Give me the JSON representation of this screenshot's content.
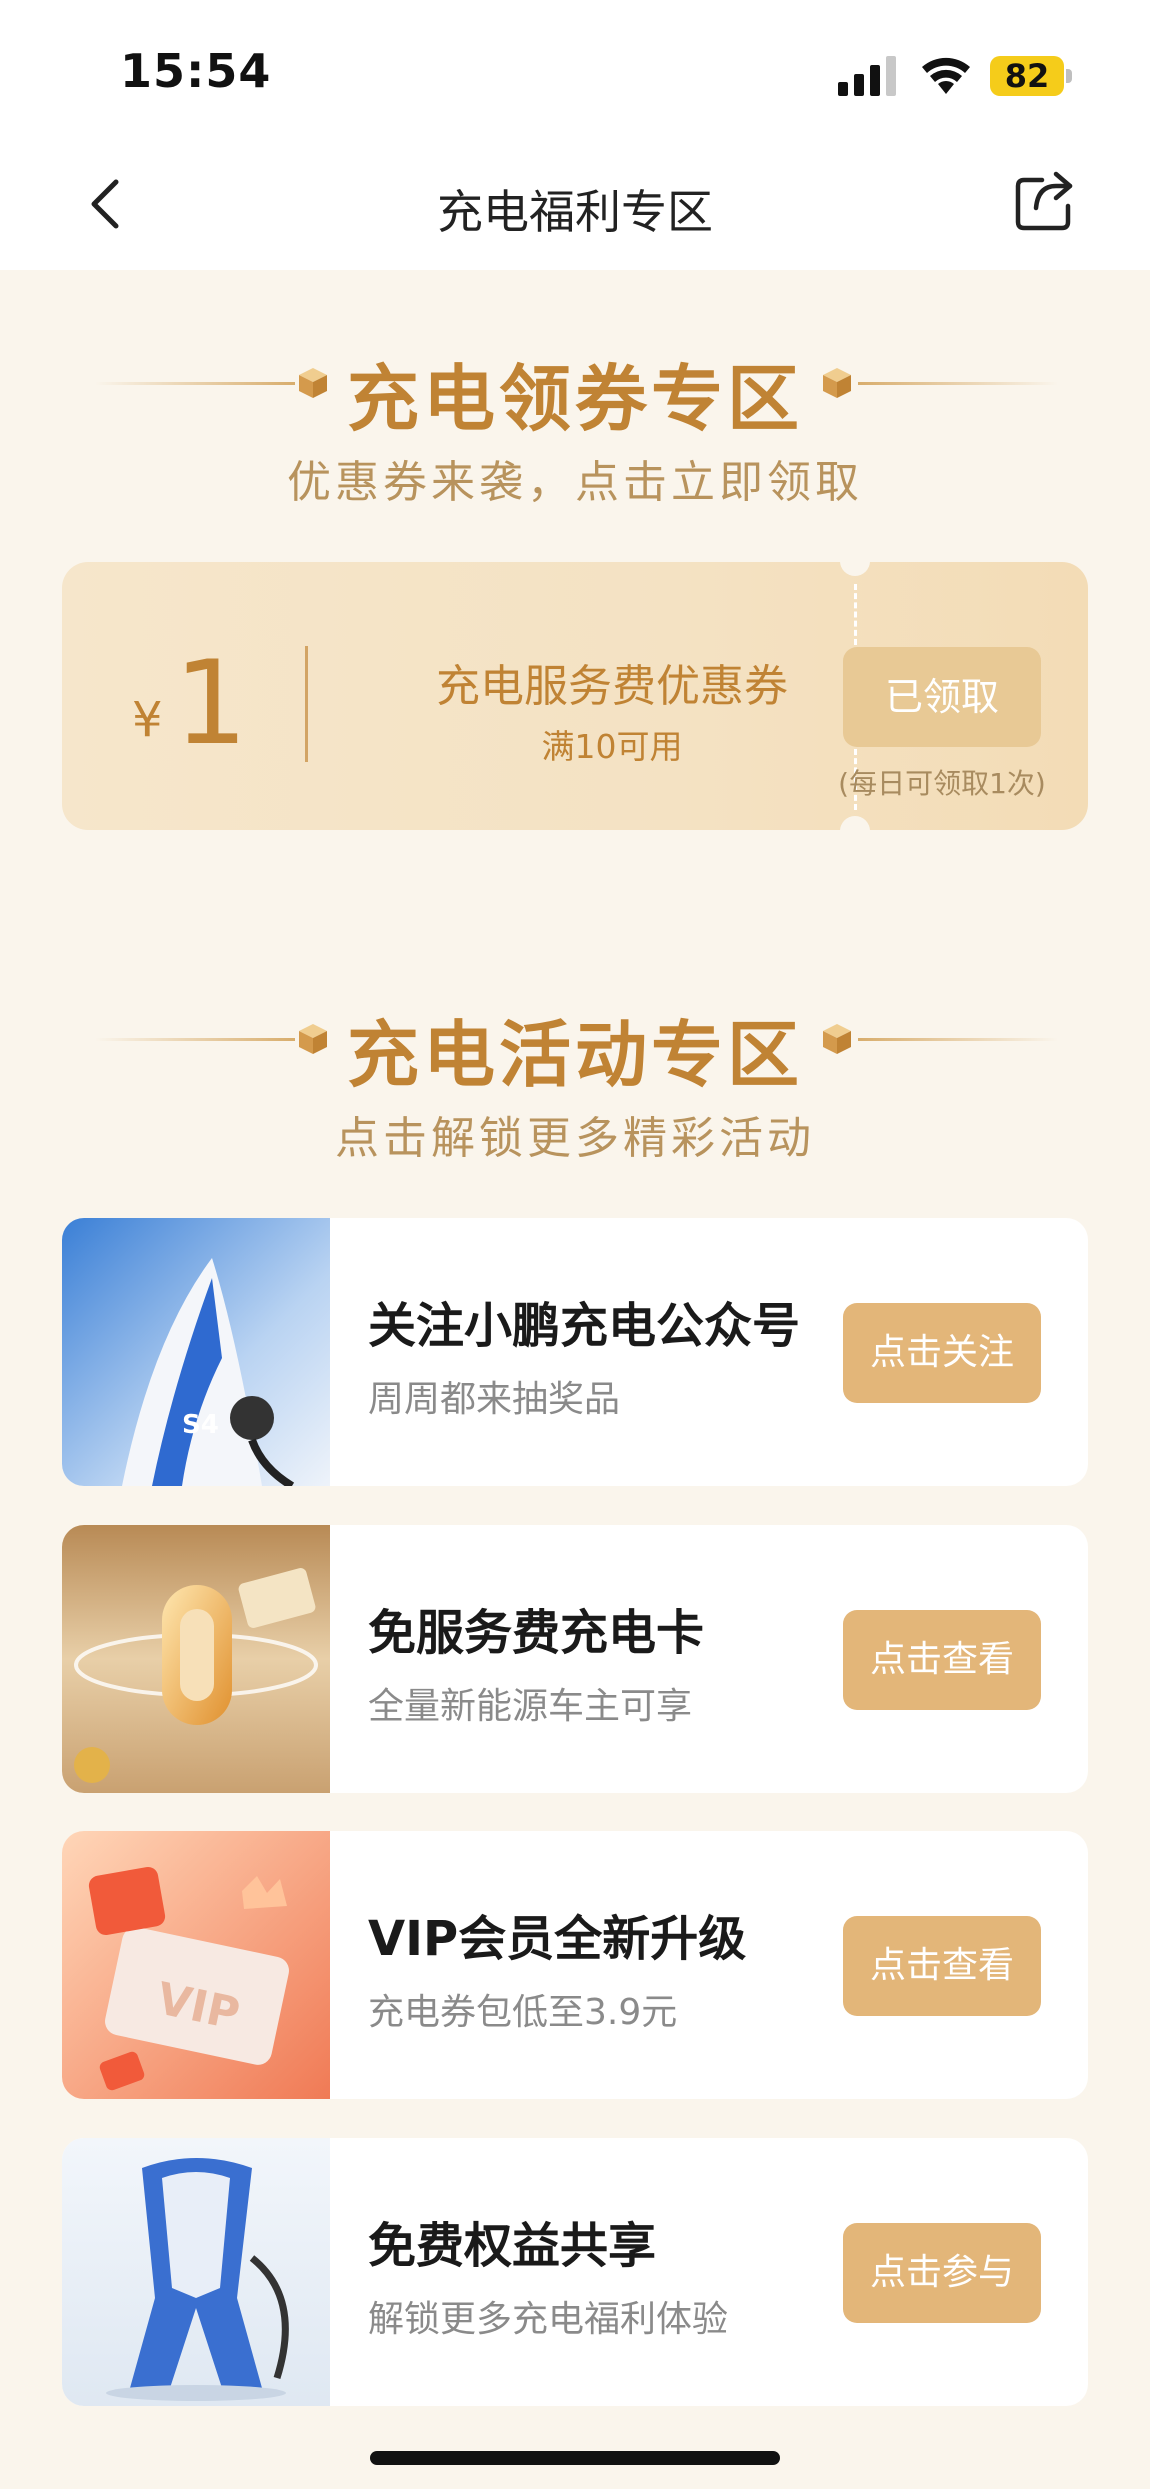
{
  "status_bar": {
    "time": "15:54",
    "battery": "82"
  },
  "nav": {
    "title": "充电福利专区"
  },
  "coupon_section": {
    "title": "充电领券专区",
    "subtitle": "优惠券来袭，点击立即领取",
    "coupon": {
      "currency": "¥",
      "amount": "1",
      "name": "充电服务费优惠券",
      "condition": "满10可用",
      "button": "已领取",
      "limit_note": "(每日可领取1次)"
    }
  },
  "activity_section": {
    "title": "充电活动专区",
    "subtitle": "点击解锁更多精彩活动",
    "items": [
      {
        "title": "关注小鹏充电公众号",
        "subtitle": "周周都来抽奖品",
        "button": "点击关注"
      },
      {
        "title": "免服务费充电卡",
        "subtitle": "全量新能源车主可享",
        "button": "点击查看"
      },
      {
        "title": "VIP会员全新升级",
        "subtitle": "充电券包低至3.9元",
        "button": "点击查看"
      },
      {
        "title": "免费权益共享",
        "subtitle": "解锁更多充电福利体验",
        "button": "点击参与"
      }
    ]
  }
}
